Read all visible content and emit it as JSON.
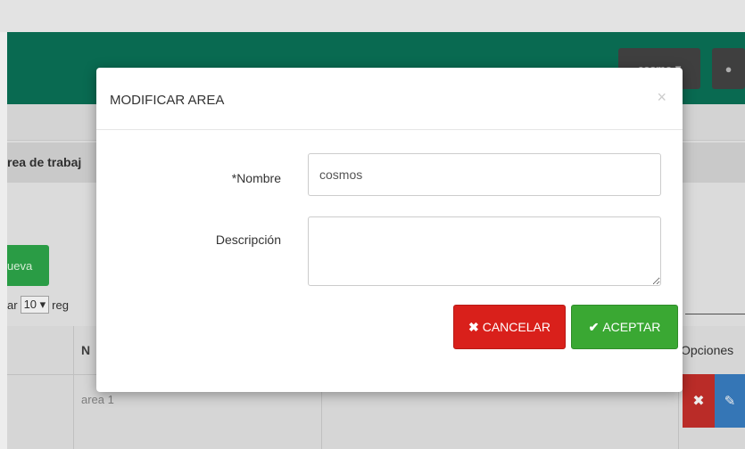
{
  "header": {
    "user_menu_label": "cosmo",
    "tag_icon": "tag-icon",
    "accent_color": "#0a7358"
  },
  "page": {
    "title": "rea de trabaj",
    "new_button_label": "ueva",
    "show_prefix": "ar",
    "show_count": "10",
    "show_suffix": "reg"
  },
  "table": {
    "headers": {
      "name": "N",
      "options": "Opciones"
    },
    "rows": [
      {
        "name": "area 1"
      }
    ]
  },
  "modal": {
    "title": "MODIFICAR AREA",
    "close_symbol": "×",
    "fields": {
      "nombre_label": "*Nombre",
      "nombre_value": "cosmos",
      "descripcion_label": "Descripción",
      "descripcion_value": ""
    },
    "buttons": {
      "cancel_icon": "✖",
      "cancel_label": "CANCELAR",
      "accept_icon": "✔",
      "accept_label": "ACEPTAR"
    }
  }
}
